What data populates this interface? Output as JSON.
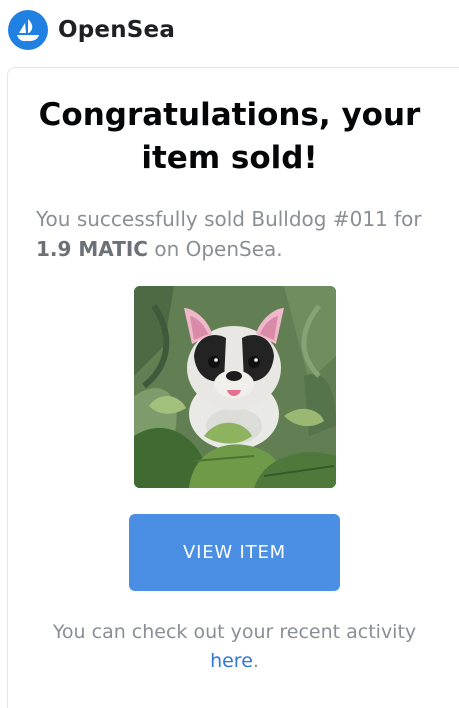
{
  "brand": {
    "name": "OpenSea",
    "icon": "opensea-boat-icon",
    "color": "#2081e2"
  },
  "email": {
    "headline_line1": "Congratulations, your",
    "headline_line2": "item sold!",
    "desc_prefix": "You successfully sold Bulldog #011 for",
    "price": "1.9 MATIC",
    "desc_suffix": "on OpenSea.",
    "nft_image": "bulldog-in-jungle-artwork",
    "button_label": "VIEW ITEM",
    "button_color": "#4a8fe3",
    "footer_prefix": "You can check out your recent activity",
    "footer_link": "here",
    "footer_suffix": "."
  }
}
